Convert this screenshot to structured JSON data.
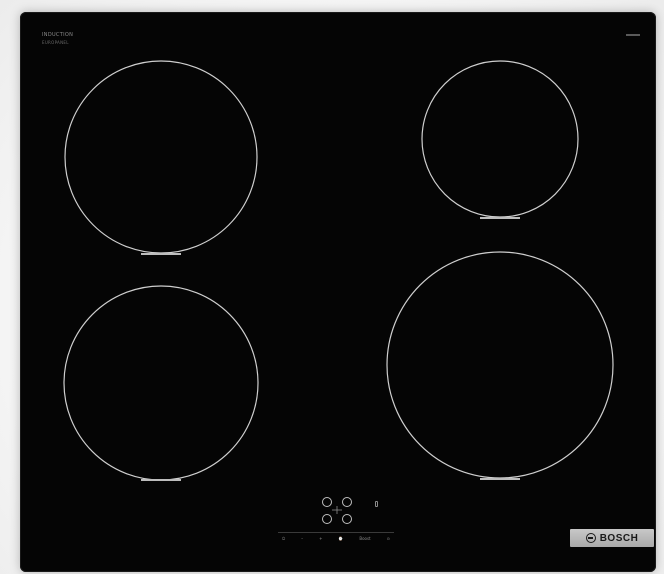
{
  "appliance": {
    "type_label": "INDUCTION",
    "type_sublabel": "EUROPANEL",
    "brand": "BOSCH",
    "brand_icon": "bosch-armature-icon"
  },
  "controls": {
    "items": [
      "⏻",
      "–",
      "+",
      "⌚",
      "Boost",
      "⊙"
    ],
    "power_icon": "power-icon",
    "boost_icon": "boost-icon"
  },
  "colors": {
    "glass": "#050505",
    "zone_outline": "#cfcfcf",
    "zone_marker": "#bdbdbd",
    "plate": "#b8b8b8"
  },
  "cooking_zones": [
    {
      "name": "front-left"
    },
    {
      "name": "rear-left"
    },
    {
      "name": "rear-right"
    },
    {
      "name": "front-right"
    }
  ]
}
